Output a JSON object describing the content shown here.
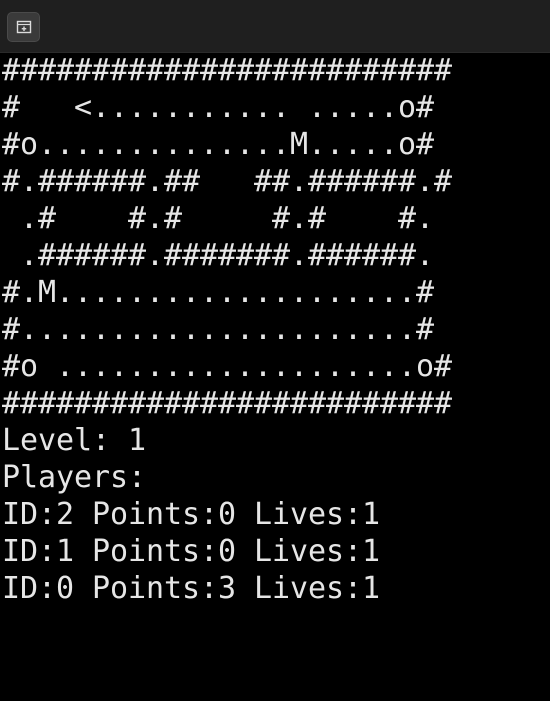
{
  "toolbar": {
    "new_tab_icon": "new-tab-icon"
  },
  "board": {
    "rows": [
      "#########################",
      "#   <........... .....o#",
      "#o..............M.....o#",
      "#.######.##   ##.######.#",
      " .#    #.#     #.#    #.",
      " .######.#######.######.",
      "#.M....................#",
      "#......................#",
      "#o ....................o#",
      "#########################"
    ]
  },
  "status": {
    "level_line": "Level: 1",
    "players_header": "Players:",
    "players": [
      "ID:2 Points:0 Lives:1",
      "ID:1 Points:0 Lives:1",
      "ID:0 Points:3 Lives:1"
    ]
  }
}
